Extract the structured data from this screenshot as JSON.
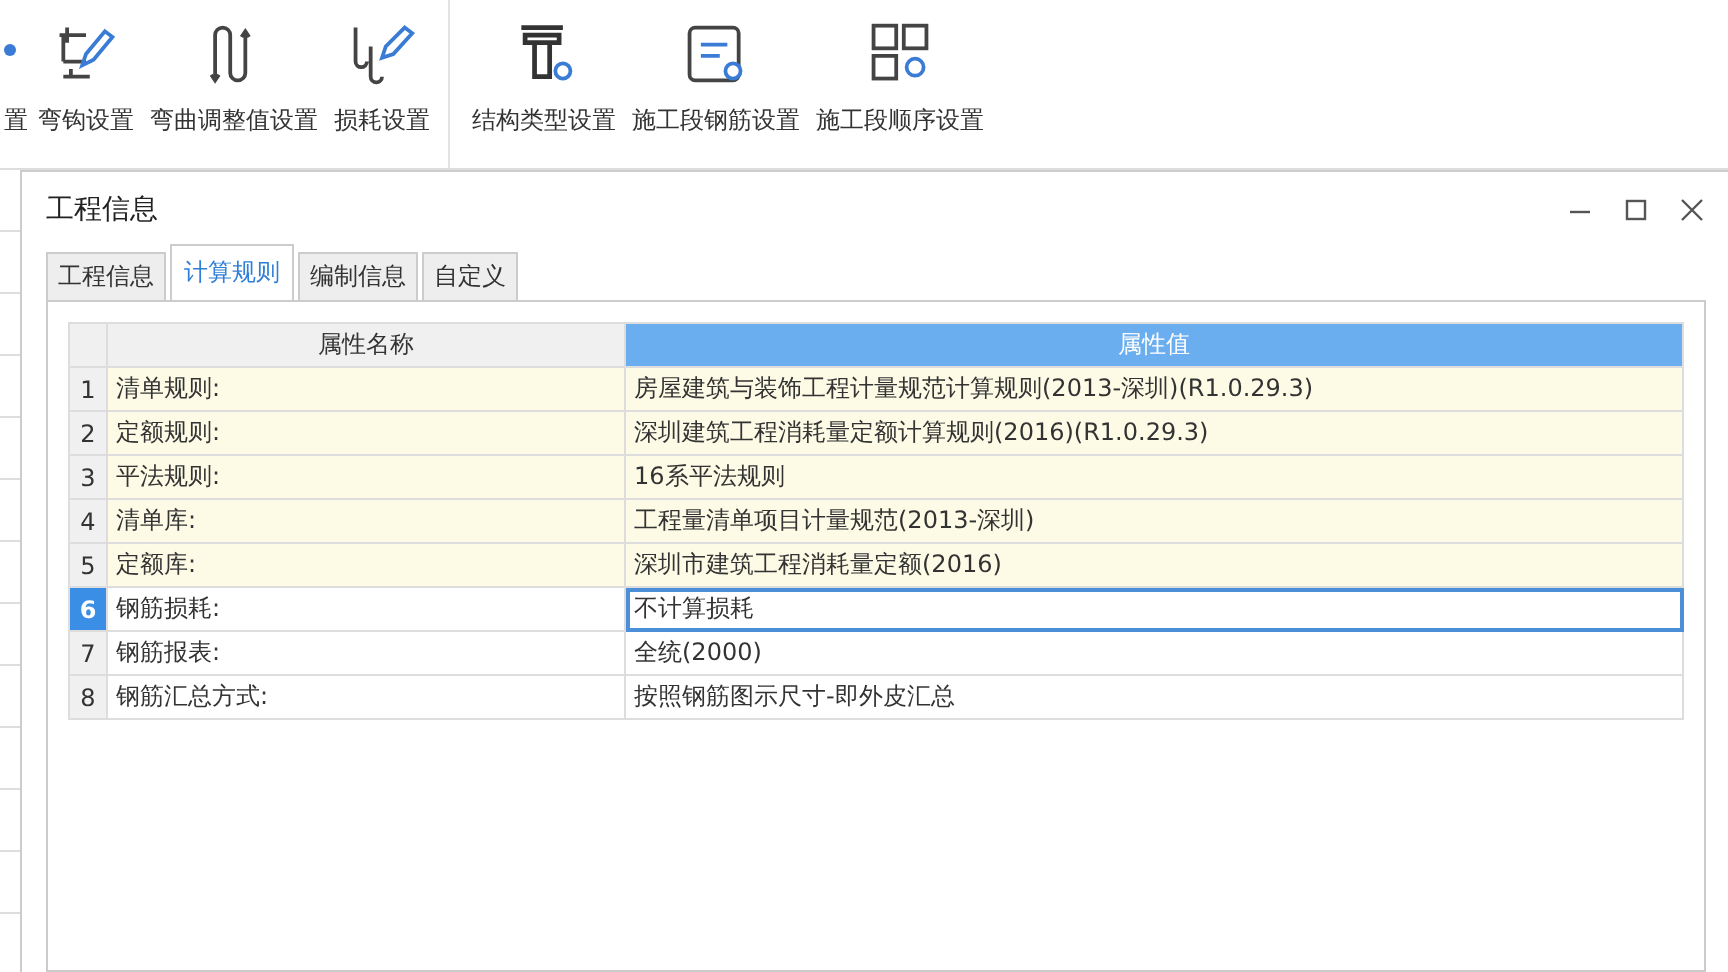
{
  "ribbon": {
    "groups": [
      {
        "items": [
          {
            "label": "置",
            "kind": "partial"
          },
          {
            "label": "弯钩设置",
            "kind": "hook"
          },
          {
            "label": "弯曲调整值设置",
            "kind": "bend"
          },
          {
            "label": "损耗设置",
            "kind": "loss"
          }
        ]
      },
      {
        "items": [
          {
            "label": "结构类型设置",
            "kind": "structure"
          },
          {
            "label": "施工段钢筋设置",
            "kind": "segment"
          },
          {
            "label": "施工段顺序设置",
            "kind": "order"
          }
        ]
      }
    ]
  },
  "dialog": {
    "title": "工程信息",
    "tabs": [
      {
        "label": "工程信息",
        "selected": false
      },
      {
        "label": "计算规则",
        "selected": true
      },
      {
        "label": "编制信息",
        "selected": false
      },
      {
        "label": "自定义",
        "selected": false
      }
    ],
    "table": {
      "columns": [
        "属性名称",
        "属性值"
      ],
      "rows": [
        {
          "index": "1",
          "name": "清单规则:",
          "value": "房屋建筑与装饰工程计量规范计算规则(2013-深圳)(R1.0.29.3)",
          "shaded": true,
          "selected": false
        },
        {
          "index": "2",
          "name": "定额规则:",
          "value": "深圳建筑工程消耗量定额计算规则(2016)(R1.0.29.3)",
          "shaded": true,
          "selected": false
        },
        {
          "index": "3",
          "name": "平法规则:",
          "value": "16系平法规则",
          "shaded": true,
          "selected": false
        },
        {
          "index": "4",
          "name": "清单库:",
          "value": "工程量清单项目计量规范(2013-深圳)",
          "shaded": true,
          "selected": false
        },
        {
          "index": "5",
          "name": "定额库:",
          "value": "深圳市建筑工程消耗量定额(2016)",
          "shaded": true,
          "selected": false
        },
        {
          "index": "6",
          "name": "钢筋损耗:",
          "value": "不计算损耗",
          "shaded": false,
          "selected": true
        },
        {
          "index": "7",
          "name": "钢筋报表:",
          "value": "全统(2000)",
          "shaded": false,
          "selected": false
        },
        {
          "index": "8",
          "name": "钢筋汇总方式:",
          "value": "按照钢筋图示尺寸-即外皮汇总",
          "shaded": false,
          "selected": false
        }
      ]
    }
  }
}
